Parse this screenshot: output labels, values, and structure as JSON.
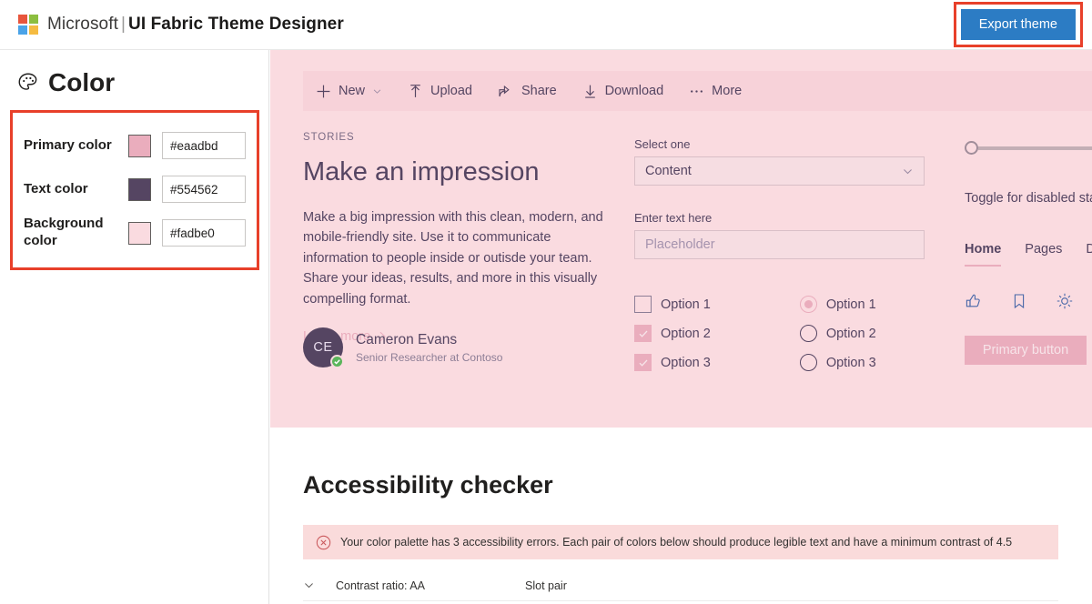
{
  "header": {
    "brand": "Microsoft",
    "separator": "|",
    "product": "UI Fabric Theme Designer",
    "export_label": "Export theme",
    "logo_colors": [
      "#e8553c",
      "#8cbe3f",
      "#4aa3e8",
      "#f5bb41"
    ],
    "export_bg": "#2c7cc4",
    "highlight_color": "#e8402a"
  },
  "sidebar": {
    "title": "Color",
    "rows": [
      {
        "label": "Primary color",
        "value": "#eaadbd",
        "swatch": "#eaadbd"
      },
      {
        "label": "Text color",
        "value": "#554562",
        "swatch": "#554562"
      },
      {
        "label": "Background color",
        "value": "#fadbe0",
        "swatch": "#fadbe0"
      }
    ]
  },
  "preview": {
    "background": "#fadbe0",
    "commandbar": [
      {
        "label": "New",
        "icon": "add-icon",
        "has_chevron": true
      },
      {
        "label": "Upload",
        "icon": "upload-icon",
        "has_chevron": false
      },
      {
        "label": "Share",
        "icon": "share-icon",
        "has_chevron": false
      },
      {
        "label": "Download",
        "icon": "download-icon",
        "has_chevron": false
      },
      {
        "label": "More",
        "icon": "more-icon",
        "has_chevron": false
      }
    ],
    "hero": {
      "eyebrow": "STORIES",
      "heading": "Make an impression",
      "body": "Make a big impression with this clean, modern, and mobile-friendly site. Use it to communicate information to people inside or outisde your team. Share your ideas, results, and more in this visually compelling format.",
      "link": "Learn more"
    },
    "persona": {
      "initials": "CE",
      "name": "Cameron Evans",
      "role": "Senior Researcher at Contoso",
      "presence": "available"
    },
    "form": {
      "select_label": "Select one",
      "select_value": "Content",
      "text_label": "Enter text here",
      "text_placeholder": "Placeholder"
    },
    "checkboxes": [
      {
        "label": "Option 1",
        "checked": false
      },
      {
        "label": "Option 2",
        "checked": true
      },
      {
        "label": "Option 3",
        "checked": true
      }
    ],
    "radios": [
      {
        "label": "Option 1",
        "selected": true
      },
      {
        "label": "Option 2",
        "selected": false
      },
      {
        "label": "Option 3",
        "selected": false
      }
    ],
    "slider": {
      "value": 0
    },
    "toggle_label": "Toggle for disabled state",
    "pivot": [
      {
        "label": "Home",
        "active": true
      },
      {
        "label": "Pages",
        "active": false
      },
      {
        "label": "Do",
        "active": false
      }
    ],
    "icons": [
      "thumbs-up-icon",
      "bookmark-icon",
      "brightness-icon"
    ],
    "primary_button": "Primary button"
  },
  "checker": {
    "title": "Accessibility checker",
    "message": "Your color palette has 3 accessibility errors. Each pair of colors below should produce legible text and have a minimum contrast of 4.5",
    "error_count": "3",
    "columns": {
      "ratio": "Contrast ratio: AA",
      "pair": "Slot pair"
    }
  }
}
